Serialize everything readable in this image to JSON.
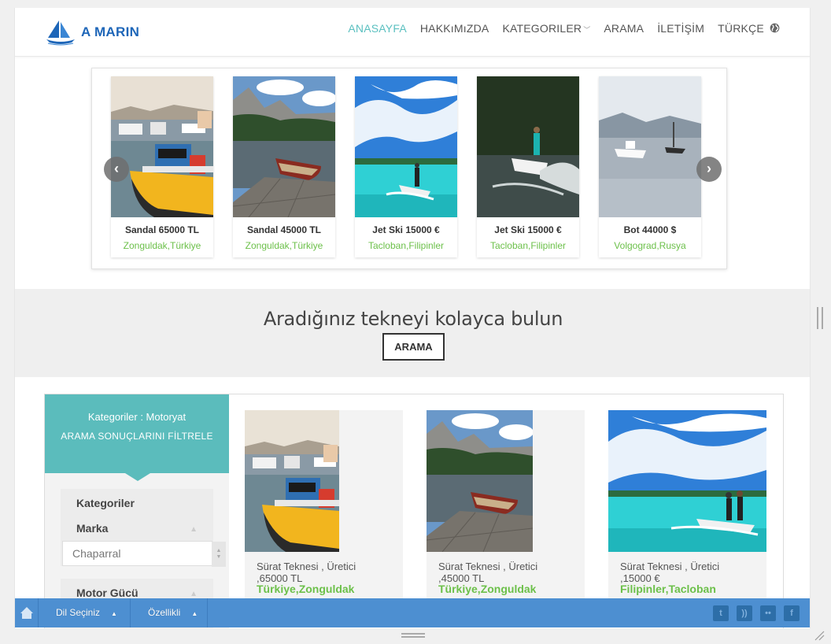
{
  "brand": {
    "name": "A MARIN"
  },
  "nav": {
    "items": [
      {
        "label": "ANASAYFA",
        "active": true
      },
      {
        "label": "HAKKıMıZDA",
        "active": false
      },
      {
        "label": "KATEGORILER",
        "active": false,
        "dropdown": true
      },
      {
        "label": "ARAMA",
        "active": false
      },
      {
        "label": "İLETİŞİM",
        "active": false
      },
      {
        "label": "TÜRKÇE",
        "active": false,
        "icon": "globe-icon"
      }
    ]
  },
  "carousel": {
    "cards": [
      {
        "name": "Sandal 65000 TL",
        "location": "Zonguldak,Türkiye",
        "image": "harbor-boat"
      },
      {
        "name": "Sandal 45000 TL",
        "location": "Zonguldak,Türkiye",
        "image": "rowboat-lake"
      },
      {
        "name": "Jet Ski 15000 €",
        "location": "Tacloban,Filipinler",
        "image": "jetski-turquoise"
      },
      {
        "name": "Jet Ski 15000 €",
        "location": "Tacloban,Filipinler",
        "image": "jetski-dark"
      },
      {
        "name": "Bot 44000 $",
        "location": "Volgograd,Rusya",
        "image": "boats-calm"
      }
    ],
    "prev_icon": "chevron-left-icon",
    "next_icon": "chevron-right-icon"
  },
  "search_band": {
    "title": "Aradığınız tekneyi kolayca bulun",
    "button": "ARAMA"
  },
  "filter": {
    "header_category": "Kategoriler : Motoryat",
    "header_subtitle": "ARAMA SONUÇLARINI FİLTRELE",
    "group1_title": "Kategoriler",
    "group1_sub": "Marka",
    "brand_value": "Chaparral",
    "group2_title": "Motor Gücü"
  },
  "results": [
    {
      "desc_line1": "Sürat Teknesi , Üretici",
      "desc_line2": ",65000 TL",
      "location": "Türkiye,Zonguldak",
      "image": "harbor-boat"
    },
    {
      "desc_line1": "Sürat Teknesi , Üretici",
      "desc_line2": ",45000 TL",
      "location": "Türkiye,Zonguldak",
      "image": "rowboat-lake"
    },
    {
      "desc_line1": "Sürat Teknesi , Üretici",
      "desc_line2": ",15000 €",
      "location": "Filipinler,Tacloban",
      "image": "jetski-turquoise"
    }
  ],
  "bottom_bar": {
    "home_icon": "home-icon",
    "language": "Dil Seçiniz",
    "features": "Özellikli",
    "social": [
      "twitter-icon",
      "rss-icon",
      "flickr-icon",
      "facebook-icon"
    ]
  },
  "colors": {
    "accent": "#5bbcbc",
    "green": "#6cc04a",
    "bar": "#4d8fd1",
    "logo": "#1e66b8"
  }
}
